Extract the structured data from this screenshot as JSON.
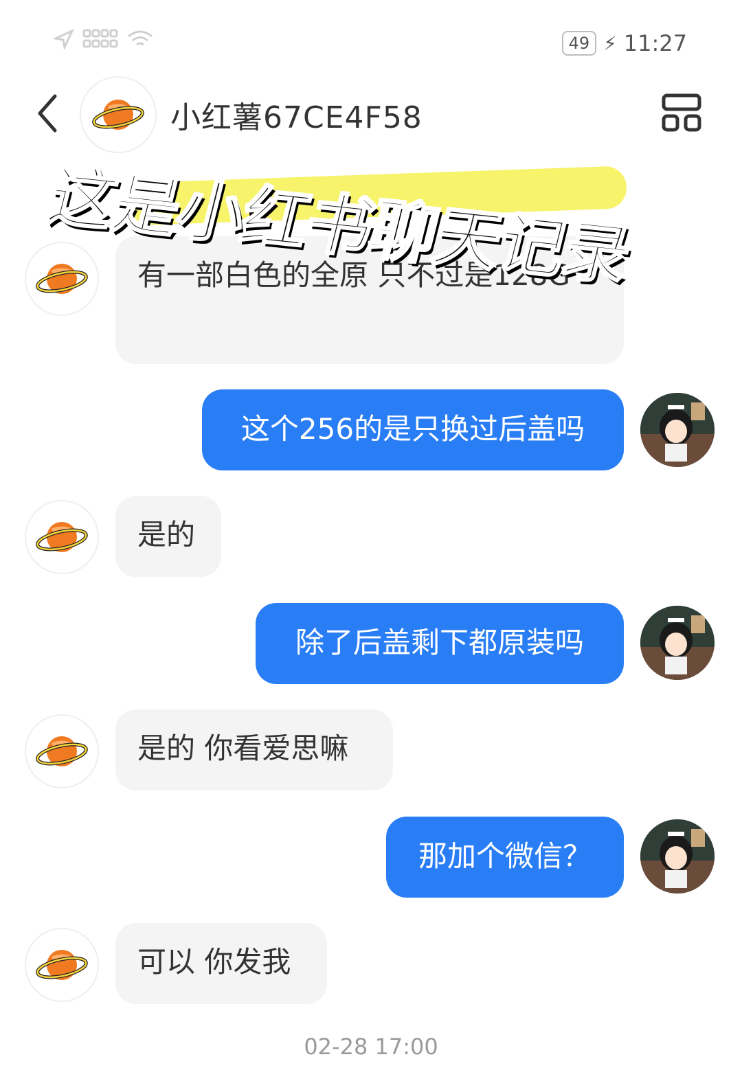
{
  "status_bar": {
    "battery": "49",
    "time": "11:27"
  },
  "header": {
    "title": "小红薯67CE4F58"
  },
  "overlay": {
    "caption": "这是小红书聊天记录"
  },
  "messages": [
    {
      "from": "other",
      "text": "有一部白色的全原 只不过是128G"
    },
    {
      "from": "me",
      "text": "这个256的是只换过后盖吗"
    },
    {
      "from": "other",
      "text": "是的"
    },
    {
      "from": "me",
      "text": "除了后盖剩下都原装吗"
    },
    {
      "from": "other",
      "text": "是的 你看爱思嘛"
    },
    {
      "from": "me",
      "text": "那加个微信？"
    },
    {
      "from": "other",
      "text": "可以 你发我"
    }
  ],
  "timestamp": "02-28 17:00",
  "colors": {
    "outgoing_bubble": "#2a7ef5",
    "incoming_bubble": "#f4f4f4",
    "planet": "#f07a22"
  }
}
